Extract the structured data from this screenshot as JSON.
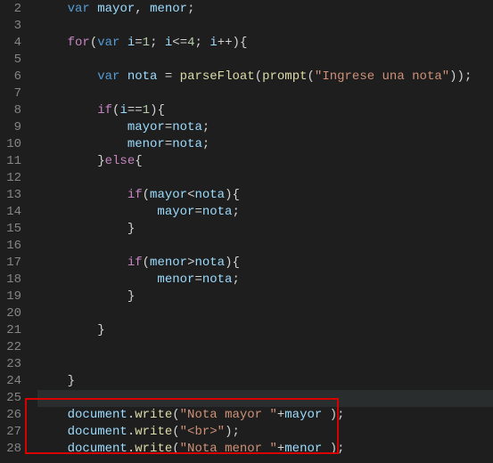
{
  "domain": "Computer-Use",
  "editor": {
    "startLine": 2,
    "activeLine": 25,
    "highlightedLines": [
      26,
      27,
      28
    ]
  },
  "gutter": {
    "l2": "2",
    "l3": "3",
    "l4": "4",
    "l5": "5",
    "l6": "6",
    "l7": "7",
    "l8": "8",
    "l9": "9",
    "l10": "10",
    "l11": "11",
    "l12": "12",
    "l13": "13",
    "l14": "14",
    "l15": "15",
    "l16": "16",
    "l17": "17",
    "l18": "18",
    "l19": "19",
    "l20": "20",
    "l21": "21",
    "l22": "22",
    "l23": "23",
    "l24": "24",
    "l25": "25",
    "l26": "26",
    "l27": "27",
    "l28": "28"
  },
  "code": {
    "l2": {
      "kw1": "var",
      "v1": "mayor",
      "c1": ", ",
      "v2": "menor",
      "sc": ";"
    },
    "l4": {
      "kw1": "for",
      "p1": "(",
      "kw2": "var",
      "v1": "i",
      "eq": "=",
      "n1": "1",
      "sc1": "; ",
      "v2": "i",
      "op": "<=",
      "n2": "4",
      "sc2": "; ",
      "v3": "i",
      "inc": "++",
      "p2": ")",
      "b": "{"
    },
    "l6": {
      "kw1": "var",
      "v1": "nota",
      "eq": " = ",
      "fn1": "parseFloat",
      "p1": "(",
      "fn2": "prompt",
      "p2": "(",
      "s1": "\"Ingrese una nota\"",
      "p3": "))",
      "sc": ";"
    },
    "l8": {
      "kw1": "if",
      "p1": "(",
      "v1": "i",
      "op": "==",
      "n1": "1",
      "p2": ")",
      "b": "{"
    },
    "l9": {
      "v1": "mayor",
      "eq": "=",
      "v2": "nota",
      "sc": ";"
    },
    "l10": {
      "v1": "menor",
      "eq": "=",
      "v2": "nota",
      "sc": ";"
    },
    "l11": {
      "cb": "}",
      "kw1": "else",
      "ob": "{"
    },
    "l13": {
      "kw1": "if",
      "p1": "(",
      "v1": "mayor",
      "op": "<",
      "v2": "nota",
      "p2": ")",
      "b": "{"
    },
    "l14": {
      "v1": "mayor",
      "eq": "=",
      "v2": "nota",
      "sc": ";"
    },
    "l15": {
      "cb": "}"
    },
    "l17": {
      "kw1": "if",
      "p1": "(",
      "v1": "menor",
      "op": ">",
      "v2": "nota",
      "p2": ")",
      "b": "{"
    },
    "l18": {
      "v1": "menor",
      "eq": "=",
      "v2": "nota",
      "sc": ";"
    },
    "l19": {
      "cb": "}"
    },
    "l21": {
      "cb": "}"
    },
    "l24": {
      "cb": "}"
    },
    "l26": {
      "v1": "document",
      "dot": ".",
      "fn": "write",
      "p1": "(",
      "s1": "\"Nota mayor \"",
      "op": "+",
      "v2": "mayor",
      "sp": " ",
      "p2": ")",
      "sc": ";"
    },
    "l27": {
      "v1": "document",
      "dot": ".",
      "fn": "write",
      "p1": "(",
      "s1": "\"<br>\"",
      "p2": ")",
      "sc": ";"
    },
    "l28": {
      "v1": "document",
      "dot": ".",
      "fn": "write",
      "p1": "(",
      "s1": "\"Nota menor \"",
      "op": "+",
      "v2": "menor",
      "sp": " ",
      "p2": ")",
      "sc": ";"
    }
  }
}
